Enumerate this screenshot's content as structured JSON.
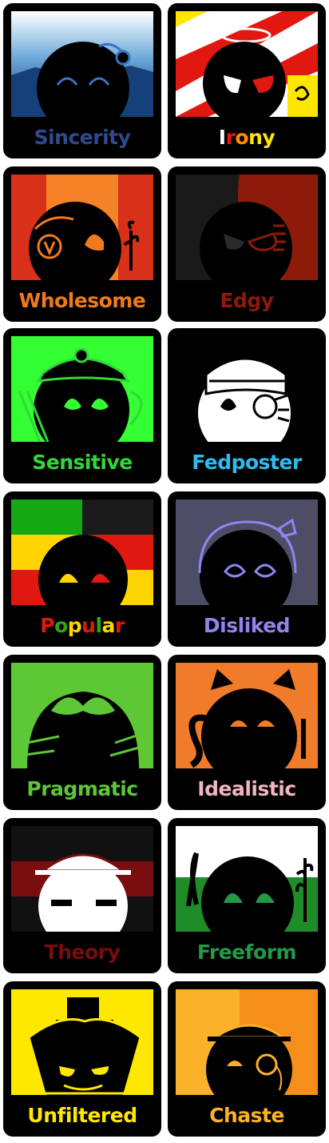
{
  "cards": [
    {
      "label": "Sincerity",
      "color": "#2f4a8f",
      "icon": "sincerity-ball-icon"
    },
    {
      "label": "Irony",
      "segments": [
        {
          "t": "I",
          "c": "#ffffff"
        },
        {
          "t": "r",
          "c": "#e0180f"
        },
        {
          "t": "o",
          "c": "#ff8c00"
        },
        {
          "t": "n",
          "c": "#ffe600"
        },
        {
          "t": "y",
          "c": "#ffe600"
        }
      ],
      "icon": "irony-ball-icon"
    },
    {
      "label": "Wholesome",
      "color": "#f07b1e",
      "icon": "wholesome-ball-icon"
    },
    {
      "label": "Edgy",
      "color": "#8e1a0a",
      "icon": "edgy-ball-icon"
    },
    {
      "label": "Sensitive",
      "color": "#33d63a",
      "icon": "sensitive-ball-icon"
    },
    {
      "label": "Fedposter",
      "color": "#2ebcf0",
      "icon": "fedposter-ball-icon"
    },
    {
      "label": "Popular",
      "segments": [
        {
          "t": "P",
          "c": "#e0180f"
        },
        {
          "t": "o",
          "c": "#2fa61a"
        },
        {
          "t": "p",
          "c": "#ffd400"
        },
        {
          "t": "u",
          "c": "#e0180f"
        },
        {
          "t": "l",
          "c": "#2fa61a"
        },
        {
          "t": "a",
          "c": "#ffd400"
        },
        {
          "t": "r",
          "c": "#e0180f"
        }
      ],
      "icon": "popular-ball-icon"
    },
    {
      "label": "Disliked",
      "color": "#8f85f0",
      "icon": "disliked-ball-icon"
    },
    {
      "label": "Pragmatic",
      "color": "#5ec736",
      "icon": "pragmatic-ball-icon"
    },
    {
      "label": "Idealistic",
      "color": "#f4b4c4",
      "icon": "idealistic-ball-icon"
    },
    {
      "label": "Theory",
      "color": "#7a0d0d",
      "icon": "theory-ball-icon"
    },
    {
      "label": "Freeform",
      "color": "#23994a",
      "icon": "freeform-ball-icon"
    },
    {
      "label": "Unfiltered",
      "color": "#ffe800",
      "icon": "unfiltered-ball-icon"
    },
    {
      "label": "Chaste",
      "color": "#fbb22a",
      "icon": "chaste-ball-icon"
    }
  ]
}
